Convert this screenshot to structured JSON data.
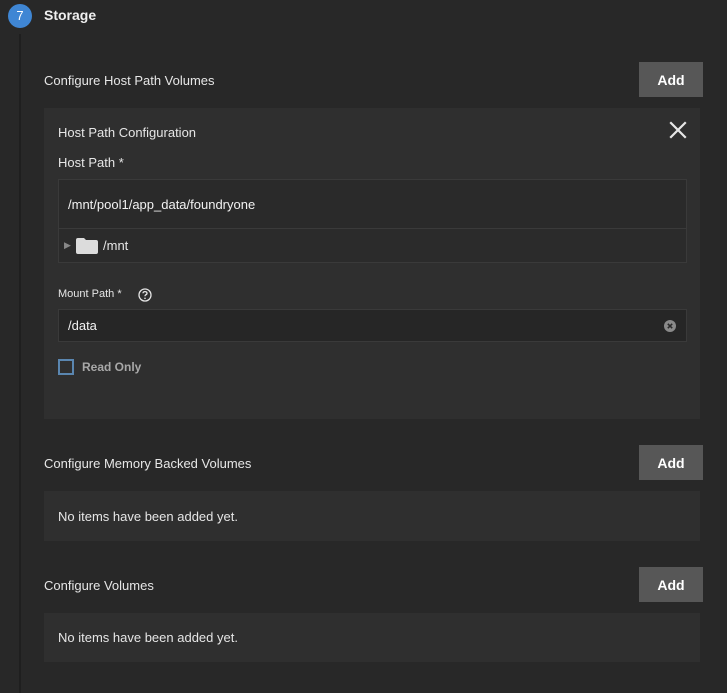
{
  "step": {
    "number": "7",
    "title": "Storage"
  },
  "host_path_volumes": {
    "label": "Configure Host Path Volumes",
    "add_label": "Add",
    "card": {
      "title": "Host Path Configuration",
      "host_path_label": "Host Path *",
      "host_path_value": "/mnt/pool1/app_data/foundryone",
      "tree_item": "/mnt",
      "mount_path_label": "Mount Path *",
      "mount_path_value": "/data",
      "read_only_label": "Read Only"
    }
  },
  "memory_backed_volumes": {
    "label": "Configure Memory Backed Volumes",
    "add_label": "Add",
    "empty_text": "No items have been added yet."
  },
  "volumes": {
    "label": "Configure Volumes",
    "add_label": "Add",
    "empty_text": "No items have been added yet."
  },
  "colors": {
    "background": "#282828",
    "card": "#2f2f2f",
    "accent": "#3f86d4",
    "button": "#575757"
  }
}
